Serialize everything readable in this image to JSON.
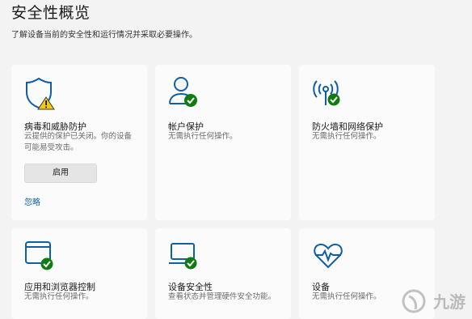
{
  "header": {
    "title": "安全性概览",
    "subtitle": "了解设备当前的安全性和运行情况并采取必要操作。"
  },
  "cards": [
    {
      "icon": "shield-warning-icon",
      "title": "病毒和威胁防护",
      "desc_line1": "云提供的保护已关闭。你的设备",
      "desc_line2": "可能易受攻击。",
      "button": "启用",
      "link": "忽略"
    },
    {
      "icon": "account-check-icon",
      "title": "帐户保护",
      "desc": "无需执行任何操作。"
    },
    {
      "icon": "firewall-antenna-check-icon",
      "title": "防火墙和网络保护",
      "desc": "无需执行任何操作。"
    },
    {
      "icon": "app-browser-check-icon",
      "title": "应用和浏览器控制",
      "desc": "无需执行任何操作。"
    },
    {
      "icon": "laptop-check-icon",
      "title": "设备安全性",
      "desc": "查看状态并管理硬件安全功能。"
    },
    {
      "icon": "heart-pulse-icon",
      "title": "设备",
      "desc": "无需执行任何操作。"
    }
  ],
  "watermark": "九游",
  "colors": {
    "icon_blue": "#0f5ea8",
    "check_green": "#107c10",
    "warning_yellow": "#f2c811",
    "background": "#f3f3f3",
    "card": "#fbfbfb"
  }
}
